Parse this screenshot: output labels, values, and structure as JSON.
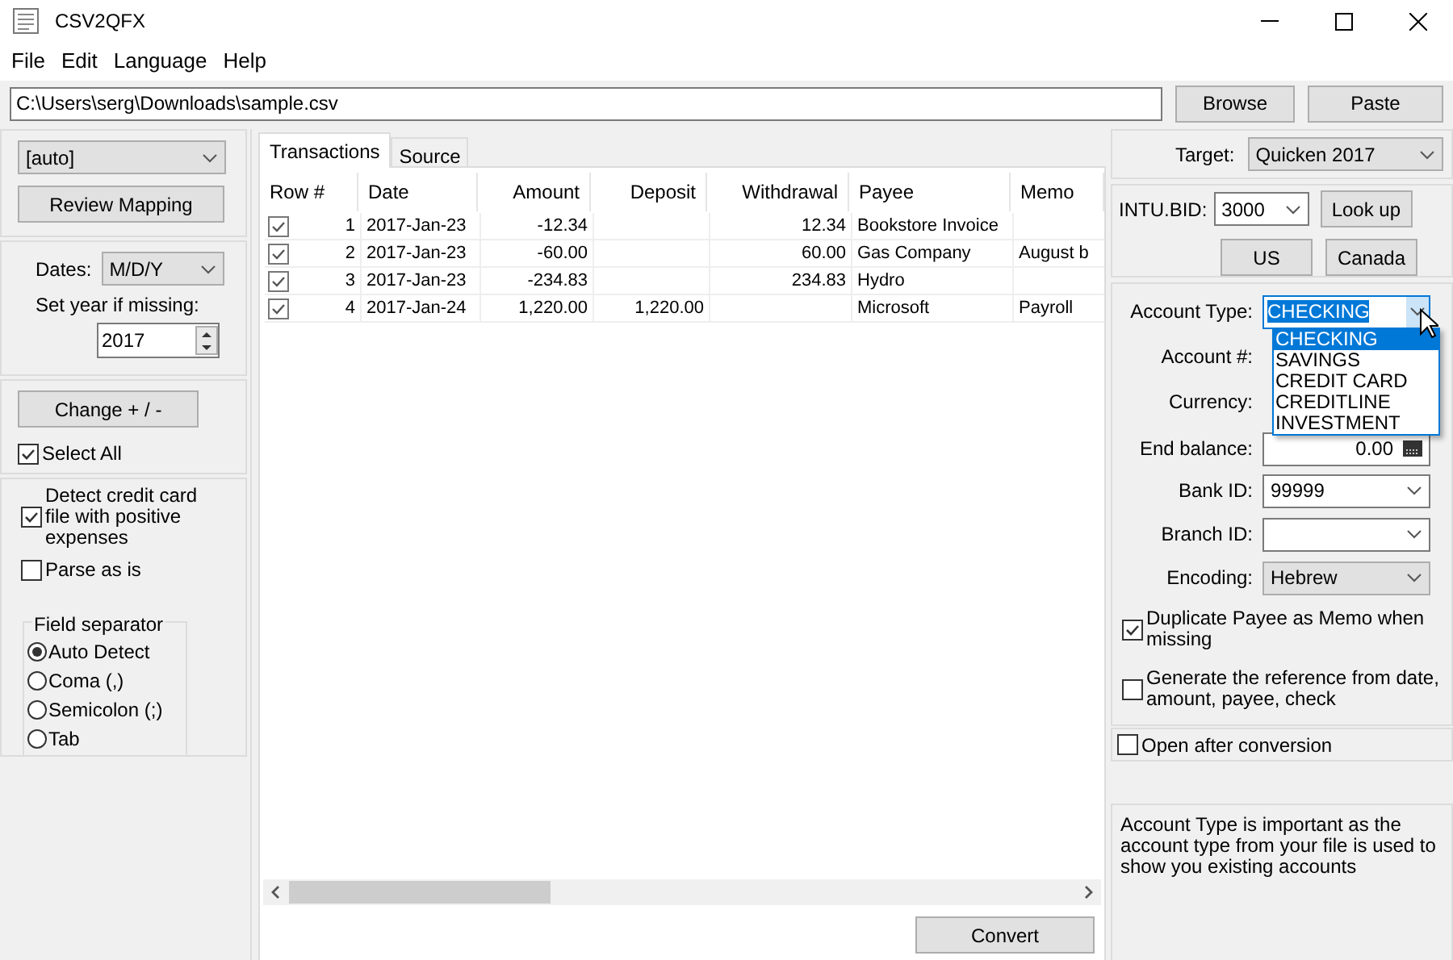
{
  "window": {
    "title": "CSV2QFX"
  },
  "menu": [
    "File",
    "Edit",
    "Language",
    "Help"
  ],
  "path": {
    "value": "C:\\Users\\serg\\Downloads\\sample.csv"
  },
  "browse_button": "Browse",
  "paste_button": "Paste",
  "left": {
    "mapping": "[auto]",
    "review_button": "Review Mapping",
    "dates_label": "Dates:",
    "date_format": "M/D/Y",
    "year_label": "Set year if missing:",
    "year": "2017",
    "change_button": "Change + / -",
    "checks": [
      {
        "label": "Select All",
        "checked": true
      },
      {
        "label": "Detect credit card file with positive expenses",
        "checked": true
      },
      {
        "label": "Parse as is",
        "checked": false
      }
    ],
    "separator": {
      "title": "Field separator",
      "options": [
        {
          "label": "Auto Detect",
          "selected": true
        },
        {
          "label": "Coma (,)",
          "selected": false
        },
        {
          "label": "Semicolon (;)",
          "selected": false
        },
        {
          "label": "Tab",
          "selected": false
        }
      ]
    }
  },
  "tabs": [
    {
      "label": "Transactions",
      "selected": true
    },
    {
      "label": "Source",
      "selected": false
    }
  ],
  "table": {
    "columns": [
      "Row #",
      "Date",
      "Amount",
      "Deposit",
      "Withdrawal",
      "Payee",
      "Memo"
    ],
    "rows": [
      {
        "checked": true,
        "cells": [
          "1",
          "2017-Jan-23",
          "-12.34",
          "",
          "12.34",
          "Bookstore Invoice",
          ""
        ]
      },
      {
        "checked": true,
        "cells": [
          "2",
          "2017-Jan-23",
          "-60.00",
          "",
          "60.00",
          "Gas Company",
          "August b"
        ]
      },
      {
        "checked": true,
        "cells": [
          "3",
          "2017-Jan-23",
          "-234.83",
          "",
          "234.83",
          "Hydro",
          ""
        ]
      },
      {
        "checked": true,
        "cells": [
          "4",
          "2017-Jan-24",
          "1,220.00",
          "1,220.00",
          "",
          "Microsoft",
          "Payroll"
        ]
      }
    ]
  },
  "convert_button": "Convert",
  "right": {
    "target_label": "Target:",
    "target": "Quicken 2017",
    "bid_label": "INTU.BID:",
    "bid": "3000",
    "lookup_button": "Look up",
    "us_button": "US",
    "canada_button": "Canada",
    "account_type_label": "Account Type:",
    "account_type": "CHECKING",
    "account_type_options": [
      {
        "label": "CHECKING",
        "selected": true
      },
      {
        "label": "SAVINGS",
        "selected": false
      },
      {
        "label": "CREDIT CARD",
        "selected": false
      },
      {
        "label": "CREDITLINE",
        "selected": false
      },
      {
        "label": "INVESTMENT",
        "selected": false
      }
    ],
    "account_label": "Account #:",
    "currency_label": "Currency:",
    "balance_label": "End balance:",
    "balance": "0.00",
    "bank_label": "Bank ID:",
    "bank": "99999",
    "branch_label": "Branch ID:",
    "encoding_label": "Encoding:",
    "encoding": "Hebrew",
    "checks": [
      {
        "label": "Duplicate Payee as Memo when missing",
        "checked": true
      },
      {
        "label": "Generate the reference from date, amount, payee, check",
        "checked": false
      }
    ],
    "open_after": {
      "label": "Open after conversion",
      "checked": false
    },
    "help": "Account Type is important as the account type from your file is used to show you existing accounts"
  }
}
